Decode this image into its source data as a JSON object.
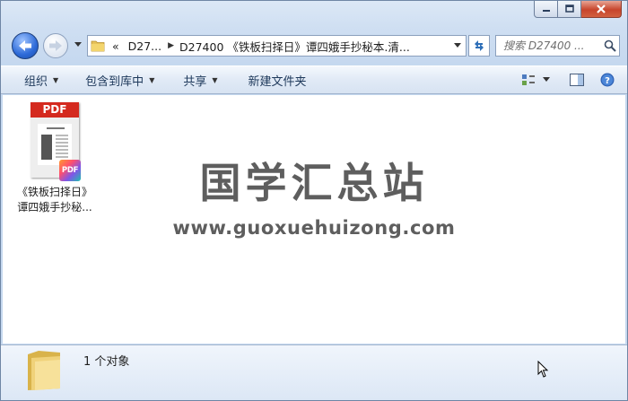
{
  "window": {
    "caption_buttons": [
      "minimize",
      "maximize",
      "close"
    ]
  },
  "nav": {
    "back_icon": "back-arrow-icon",
    "forward_icon": "forward-arrow-icon"
  },
  "address": {
    "chevrons": "«",
    "segment1": "D27...",
    "segment2": "D27400 《铁板扫择日》谭四娥手抄秘本.清..."
  },
  "search": {
    "placeholder": "搜索 D27400 ..."
  },
  "toolbar": {
    "organize": "组织",
    "include_in_library": "包含到库中",
    "share": "共享",
    "new_folder": "新建文件夹"
  },
  "file": {
    "thumb_label": "PDF",
    "badge_label": "PDF",
    "name_line1": "《铁板扫择日》",
    "name_line2": "谭四娥手抄秘..."
  },
  "watermark": {
    "text": "国学汇总站",
    "url": "www.guoxuehuizong.com"
  },
  "details": {
    "status": "1 个对象"
  },
  "colors": {
    "accent": "#2d6ad8",
    "close_button": "#c7452c",
    "pdf_red": "#d42a1f"
  }
}
